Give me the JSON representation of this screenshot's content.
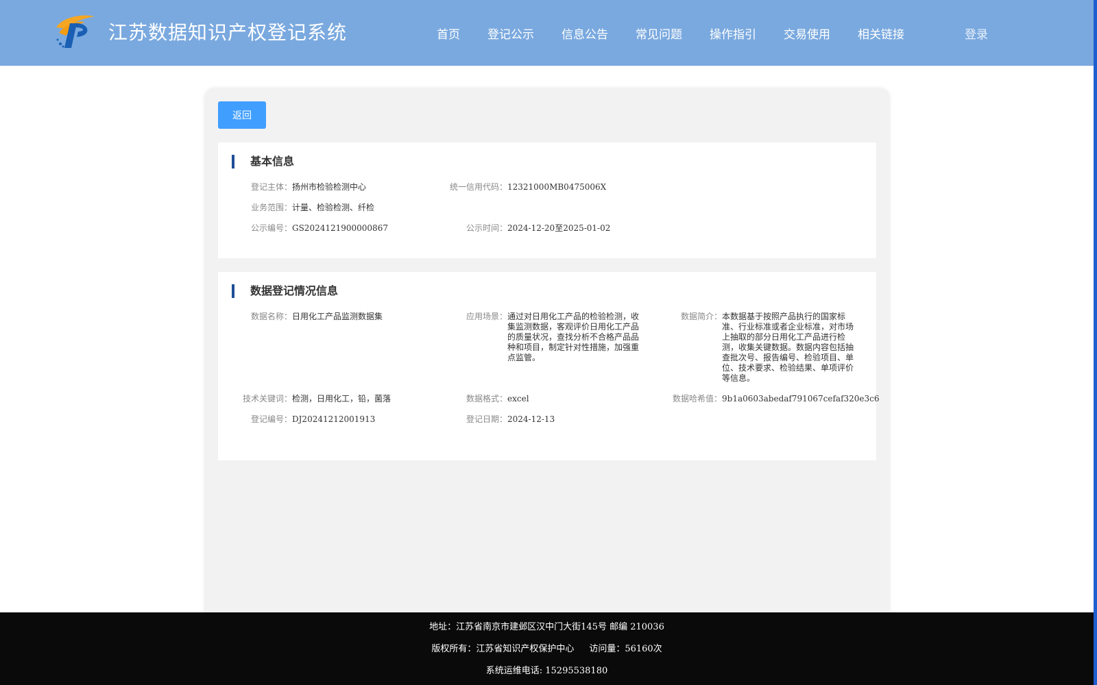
{
  "header": {
    "title": "江苏数据知识产权登记系统",
    "nav": [
      "首页",
      "登记公示",
      "信息公告",
      "常见问题",
      "操作指引",
      "交易使用",
      "相关链接"
    ],
    "login": "登录"
  },
  "back_button": "返回",
  "basic_info": {
    "title": "基本信息",
    "registrant_label": "登记主体：",
    "registrant": "扬州市检验检测中心",
    "credit_code_label": "统一信用代码：",
    "credit_code": "12321000MB0475006X",
    "scope_label": "业务范围：",
    "scope": "计量、检验检测、纤检",
    "notice_no_label": "公示编号：",
    "notice_no": "GS2024121900000867",
    "notice_time_label": "公示时间：",
    "notice_time": "2024-12-20至2025-01-02"
  },
  "data_info": {
    "title": "数据登记情况信息",
    "name_label": "数据名称：",
    "name": "日用化工产品监测数据集",
    "scenario_label": "应用场景：",
    "scenario": "通过对日用化工产品的检验检测，收集监测数据，客观评价日用化工产品的质量状况，查找分析不合格产品品种和项目，制定针对性措施，加强重点监管。",
    "intro_label": "数据简介：",
    "intro": "本数据基于按照产品执行的国家标准、行业标准或者企业标准，对市场上抽取的部分日用化工产品进行检测，收集关键数据。数据内容包括抽查批次号、报告编号、检验项目、单位、技术要求、检验结果、单项评价等信息。",
    "keywords_label": "技术关键词：",
    "keywords": "检测，日用化工，铅，菌落",
    "format_label": "数据格式：",
    "format": "excel",
    "hash_label": "数据哈希值：",
    "hash": "9b1a0603abedaf791067cefaf320e3c6",
    "reg_no_label": "登记编号：",
    "reg_no": "DJ20241212001913",
    "reg_date_label": "登记日期：",
    "reg_date": "2024-12-13"
  },
  "footer": {
    "address": "地址：江苏省南京市建邺区汉中门大街145号 邮编 210036",
    "copyright": "版权所有：江苏省知识产权保护中心",
    "visits": "访问量：56160次",
    "phone": "系统运维电话: 15295538180"
  },
  "colors": {
    "header_bg": "#7aa9df",
    "button_blue": "#409eff",
    "section_accent": "#1f4e96",
    "footer_bg": "#0a0a0a"
  }
}
